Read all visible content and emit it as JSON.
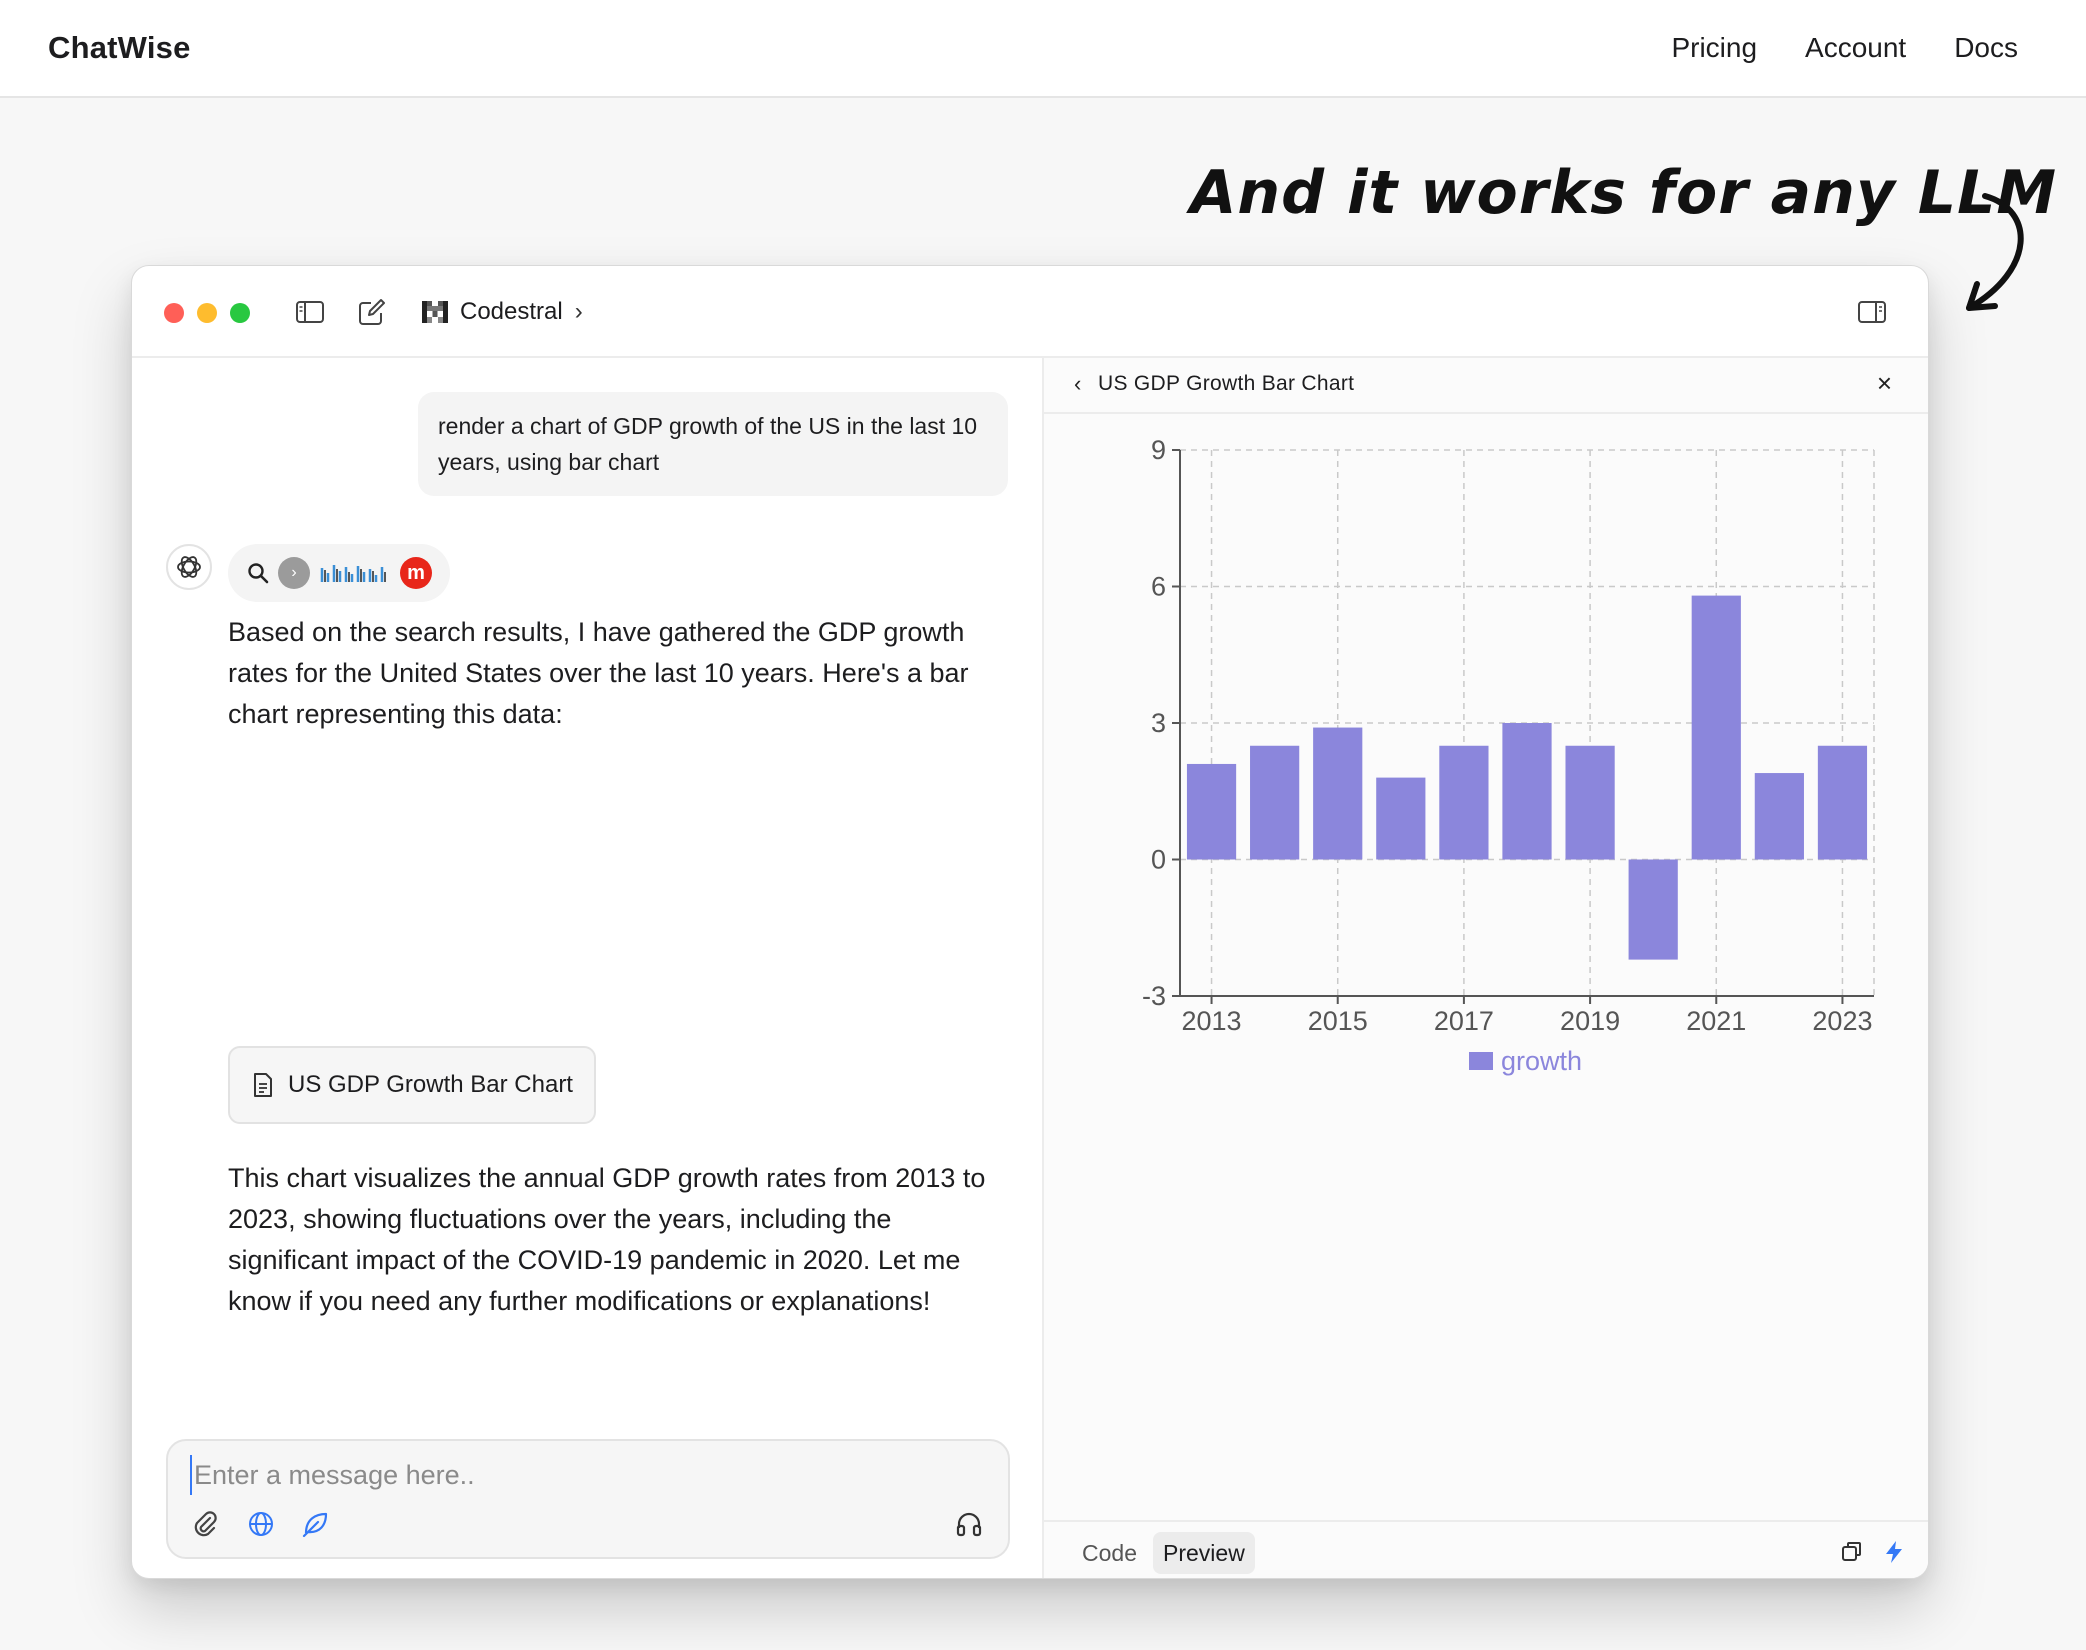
{
  "site": {
    "brand": "ChatWise",
    "nav": [
      "Pricing",
      "Account",
      "Docs"
    ],
    "tagline": "And it works for any LLM"
  },
  "window": {
    "model_name": "Codestral"
  },
  "chat": {
    "user_message": "render a chart of GDP growth of the US in the last 10 years, using bar chart",
    "assistant_intro": "Based on the search results, I have gathered the GDP growth rates for the United States over the last 10 years. Here's a bar chart representing this data:",
    "artifact_label": "US GDP Growth Bar Chart",
    "assistant_outro": "This chart visualizes the annual GDP growth rates from 2013 to 2023, showing fluctuations over the years, including the significant impact of the COVID-19 pandemic in 2020. Let me know if you need any further modifications or explanations!",
    "composer_placeholder": "Enter a message here..",
    "tool_icons": [
      "search-icon",
      "source-favicon",
      "source-favicon-red"
    ]
  },
  "preview": {
    "title": "US GDP Growth Bar Chart",
    "tabs": [
      "Code",
      "Preview"
    ],
    "active_tab": "Preview"
  },
  "colors": {
    "bar": "#8b86dc",
    "grid": "#c9c9c9",
    "axis": "#555555",
    "tick_text": "#555555",
    "legend_text": "#8b86dc"
  },
  "chart_data": {
    "type": "bar",
    "categories": [
      "2013",
      "2014",
      "2015",
      "2016",
      "2017",
      "2018",
      "2019",
      "2020",
      "2021",
      "2022",
      "2023"
    ],
    "x_tick_labels": [
      "2013",
      "2015",
      "2017",
      "2019",
      "2021",
      "2023"
    ],
    "series": [
      {
        "name": "growth",
        "values": [
          2.1,
          2.5,
          2.9,
          1.8,
          2.5,
          3.0,
          2.5,
          -2.2,
          5.8,
          1.9,
          2.5
        ]
      }
    ],
    "y_ticks": [
      -3,
      0,
      3,
      6,
      9
    ],
    "ylim": [
      -3,
      9
    ],
    "grid": true,
    "legend": "bottom-center"
  }
}
